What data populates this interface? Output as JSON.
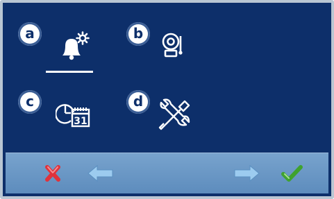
{
  "menu": {
    "items": [
      {
        "badge": "a",
        "icon": "bell-gear-icon",
        "selected": true
      },
      {
        "badge": "b",
        "icon": "alarm-bell-icon",
        "selected": false
      },
      {
        "badge": "c",
        "icon": "clock-calendar-icon",
        "calendar_day": "31",
        "selected": false
      },
      {
        "badge": "d",
        "icon": "wrench-screwdriver-icon",
        "selected": false
      }
    ]
  },
  "toolbar": {
    "buttons": [
      {
        "icon": "close-icon",
        "color": "#e0323b"
      },
      {
        "icon": "arrow-left-icon",
        "color": "#8fc3ec"
      },
      {
        "icon": "arrow-right-icon",
        "color": "#8fc3ec"
      },
      {
        "icon": "check-icon",
        "color": "#3fa22f"
      }
    ]
  },
  "colors": {
    "background": "#0d2f6a",
    "toolbar": "#6a96c6",
    "frame_border": "#b9c6d3"
  }
}
